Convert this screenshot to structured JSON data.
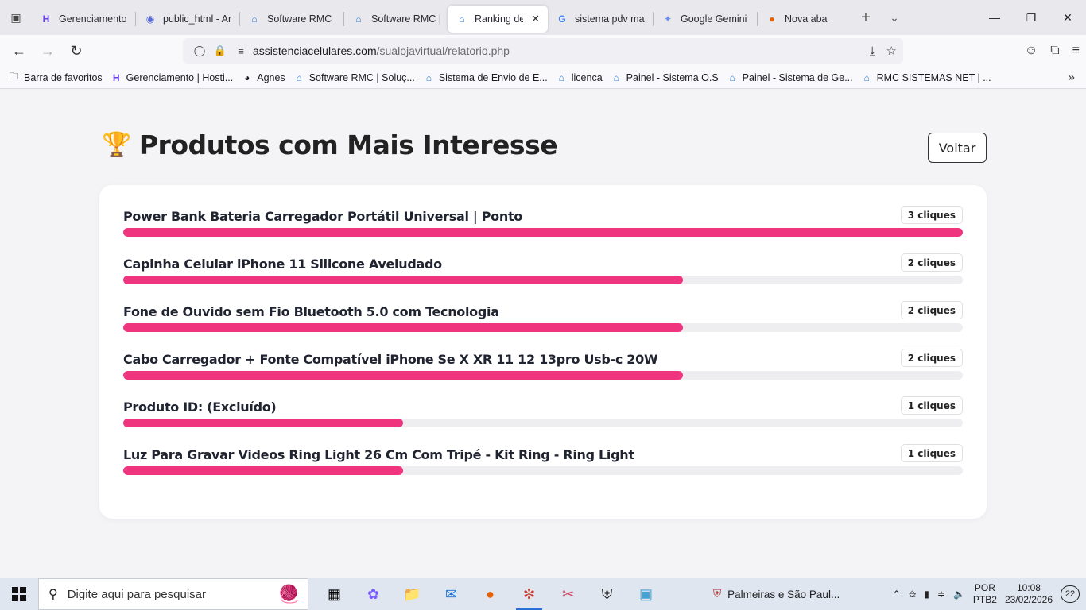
{
  "browser": {
    "tabs": [
      {
        "title": "Gerenciamento |",
        "icon": "hostinger-icon",
        "active": false
      },
      {
        "title": "public_html - Arq",
        "icon": "globe-icon",
        "active": false
      },
      {
        "title": "Software RMC | S",
        "icon": "house-icon",
        "active": false
      },
      {
        "title": "Software RMC | S",
        "icon": "house-icon",
        "active": false
      },
      {
        "title": "Ranking de Cli",
        "icon": "house-icon",
        "active": true
      },
      {
        "title": "sistema pdv mast",
        "icon": "google-icon",
        "active": false
      },
      {
        "title": "Google Gemini",
        "icon": "gemini-icon",
        "active": false
      },
      {
        "title": "Nova aba",
        "icon": "firefox-icon",
        "active": false
      }
    ],
    "url_host": "assistenciacelulares.com",
    "url_path": "/sualojavirtual/relatorio.php",
    "bookmarks": [
      {
        "label": "Barra de favoritos",
        "icon": "folder-icon"
      },
      {
        "label": "Gerenciamento | Hosti...",
        "icon": "hostinger-icon"
      },
      {
        "label": "Agnes",
        "icon": "agnes-icon"
      },
      {
        "label": "Software RMC | Soluç...",
        "icon": "house-icon"
      },
      {
        "label": "Sistema de Envio de E...",
        "icon": "house-icon"
      },
      {
        "label": "licenca",
        "icon": "house-icon"
      },
      {
        "label": "Painel - Sistema O.S",
        "icon": "house-icon"
      },
      {
        "label": "Painel - Sistema de Ge...",
        "icon": "house-icon"
      },
      {
        "label": "RMC SISTEMAS NET | ...",
        "icon": "house-icon"
      }
    ]
  },
  "page": {
    "title": "Produtos com Mais Interesse",
    "back_label": "Voltar",
    "accent_color": "#f0357f",
    "ranking": [
      {
        "name": "Power Bank Bateria Carregador Portátil Universal | Ponto",
        "badge": "3 cliques",
        "clicks": 3
      },
      {
        "name": "Capinha Celular iPhone 11 Silicone Aveludado",
        "badge": "2 cliques",
        "clicks": 2
      },
      {
        "name": "Fone de Ouvido sem Fio Bluetooth 5.0 com Tecnologia",
        "badge": "2 cliques",
        "clicks": 2
      },
      {
        "name": "Cabo Carregador + Fonte Compatível iPhone Se X XR 11 12 13pro Usb-c 20W",
        "badge": "2 cliques",
        "clicks": 2
      },
      {
        "name": "Produto ID: (Excluído)",
        "badge": "1 cliques",
        "clicks": 1
      },
      {
        "name": "Luz Para Gravar Videos Ring Light 26 Cm Com Tripé - Kit Ring - Ring Light",
        "badge": "1 cliques",
        "clicks": 1
      }
    ]
  },
  "taskbar": {
    "search_placeholder": "Digite aqui para pesquisar",
    "news": "Palmeiras e São Paul...",
    "lang_top": "POR",
    "lang_bottom": "PTB2",
    "time": "10:08",
    "date": "23/02/2026",
    "notifications": "22"
  }
}
